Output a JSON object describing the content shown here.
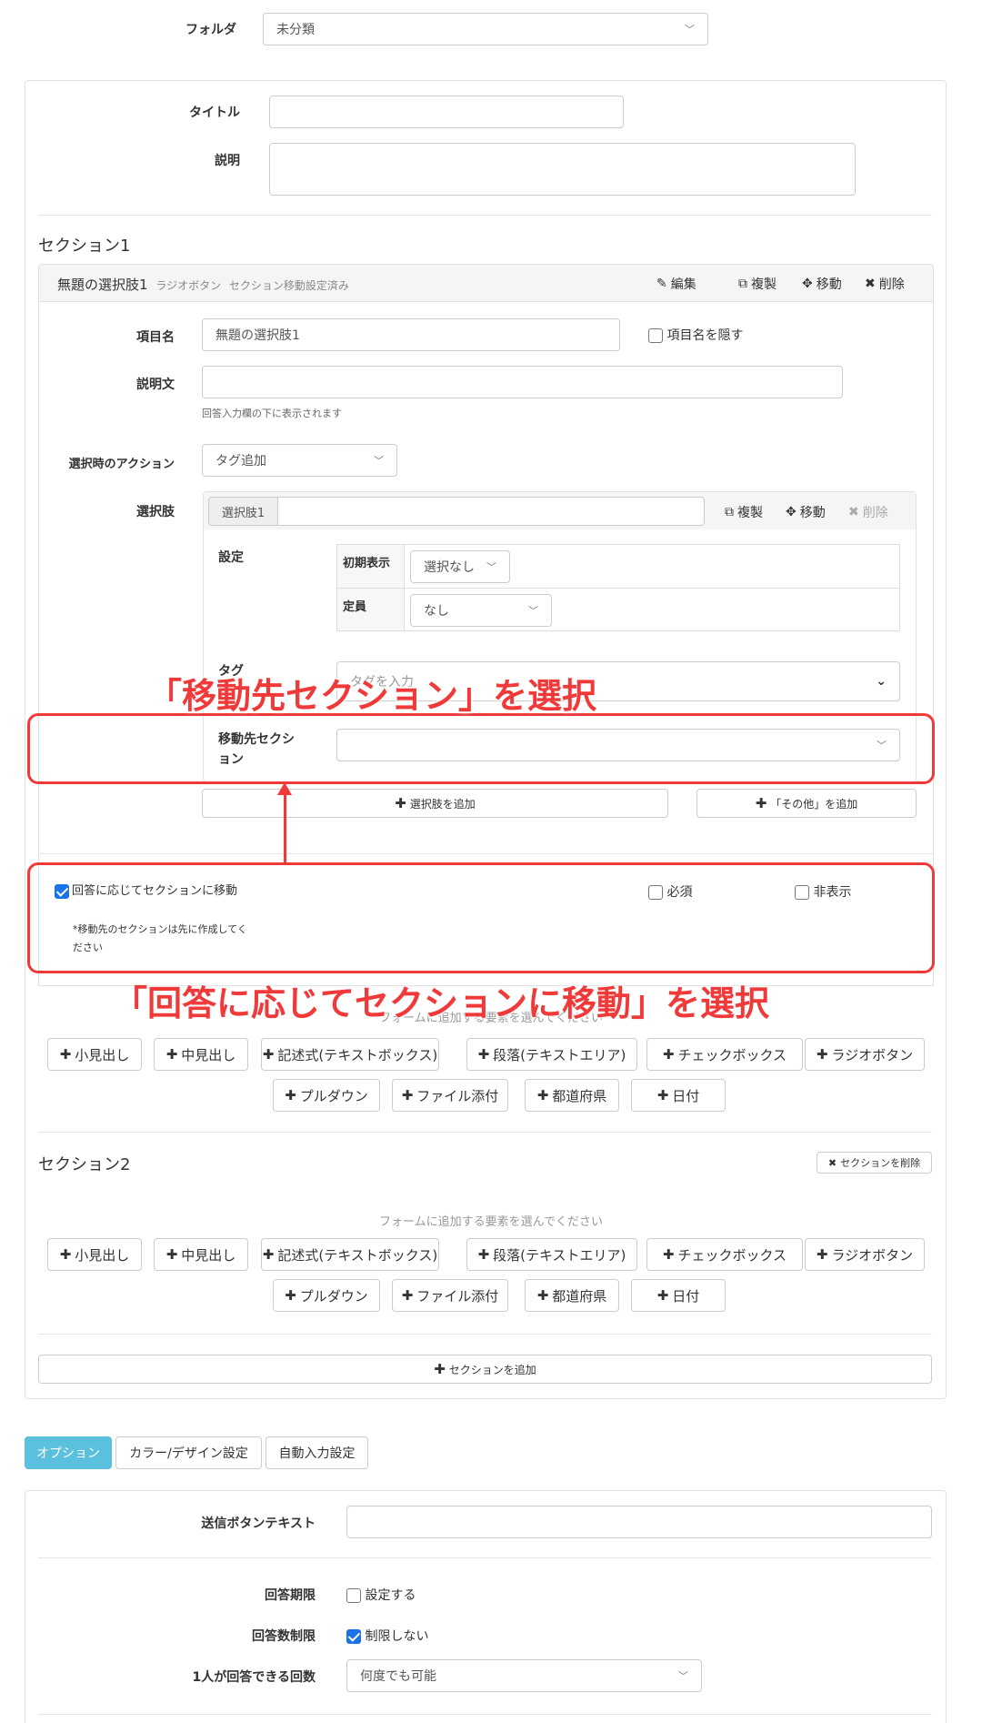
{
  "folder": {
    "label": "フォルダ",
    "value": "未分類"
  },
  "form_meta": {
    "title_label": "タイトル",
    "title_value": "",
    "desc_label": "説明",
    "desc_value": ""
  },
  "section1": {
    "title": "セクション1",
    "question": {
      "name": "無題の選択肢1",
      "type": "ラジオボタン",
      "status": "セクション移動設定済み",
      "actions": {
        "edit": "編集",
        "copy": "複製",
        "move": "移動",
        "delete": "削除"
      },
      "item_name_label": "項目名",
      "item_name_value": "無題の選択肢1",
      "hide_name_label": "項目名を隠す",
      "desc_label": "説明文",
      "desc_hint": "回答入力欄の下に表示されます",
      "action_label": "選択時のアクション",
      "action_value": "タグ追加",
      "choices_label": "選択肢",
      "choice": {
        "prefix": "選択肢1",
        "value": "",
        "actions": {
          "copy": "複製",
          "move": "移動",
          "delete": "削除"
        },
        "settings_label": "設定",
        "initial_label": "初期表示",
        "initial_value": "選択なし",
        "capacity_label": "定員",
        "capacity_value": "なし",
        "tag_label": "タグ",
        "tag_placeholder": "タグを入力",
        "dest_label": "移動先セクション",
        "dest_value": ""
      },
      "add_choice": "選択肢を追加",
      "add_other": "「その他」を追加",
      "jump_label": "回答に応じてセクションに移動",
      "jump_note": "*移動先のセクションは先に作成してください",
      "required_label": "必須",
      "hidden_label": "非表示"
    },
    "add_prompt": "フォームに追加する要素を選んでください",
    "elements": [
      "小見出し",
      "中見出し",
      "記述式(テキストボックス)",
      "段落(テキストエリア)",
      "チェックボックス",
      "ラジオボタン",
      "プルダウン",
      "ファイル添付",
      "都道府県",
      "日付"
    ]
  },
  "section2": {
    "title": "セクション2",
    "delete_label": "セクションを削除",
    "add_prompt": "フォームに追加する要素を選んでください",
    "elements": [
      "小見出し",
      "中見出し",
      "記述式(テキストボックス)",
      "段落(テキストエリア)",
      "チェックボックス",
      "ラジオボタン",
      "プルダウン",
      "ファイル添付",
      "都道府県",
      "日付"
    ]
  },
  "add_section": "セクションを追加",
  "tabs": [
    "オプション",
    "カラー/デザイン設定",
    "自動入力設定"
  ],
  "options": {
    "submit_label": "送信ボタンテキスト",
    "submit_value": "",
    "deadline_label": "回答期限",
    "deadline_check": "設定する",
    "limit_label": "回答数制限",
    "limit_check": "制限しない",
    "per_person_label": "1人が回答できる回数",
    "per_person_value": "何度でも可能"
  },
  "annotations": {
    "top": "「移動先セクション」を選択",
    "bottom": "「回答に応じてセクションに移動」を選択"
  },
  "colors": {
    "annotation": "#f03a3a",
    "active_tab": "#5bc0de",
    "checkbox": "#1a73e8"
  }
}
